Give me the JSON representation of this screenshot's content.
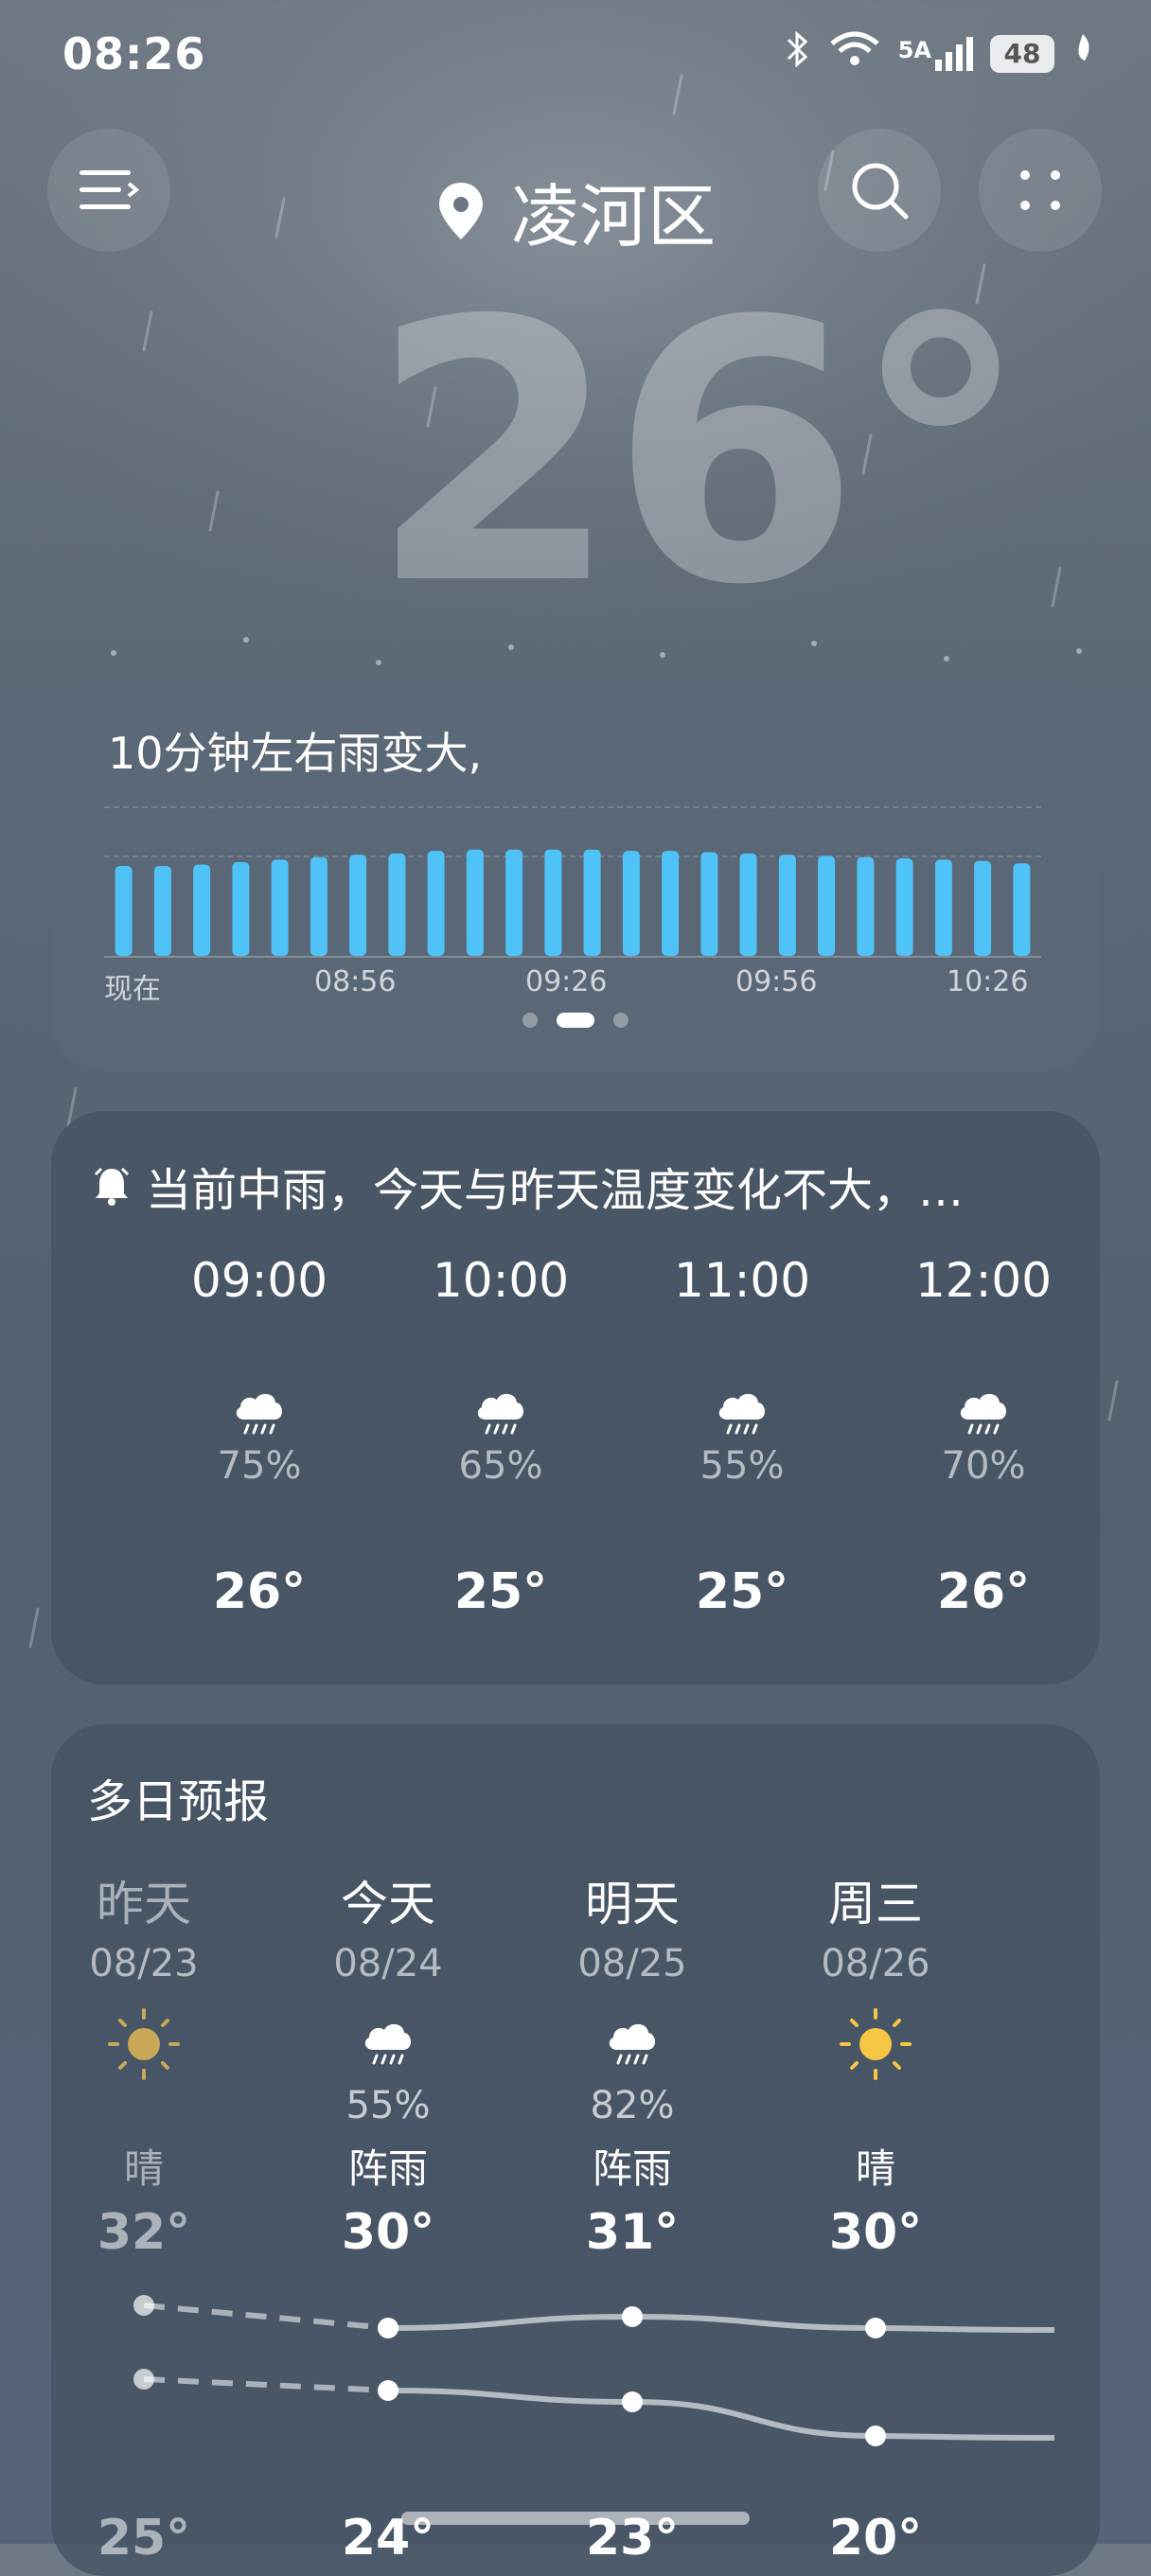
{
  "status_bar": {
    "time": "08:26",
    "network": "5A",
    "battery": "48"
  },
  "header": {
    "location": "凌河区"
  },
  "current": {
    "temperature": "26°"
  },
  "precip_card": {
    "message": "10分钟左右雨变大,",
    "bar_levels": [
      0.72,
      0.72,
      0.73,
      0.75,
      0.77,
      0.79,
      0.81,
      0.82,
      0.84,
      0.85,
      0.85,
      0.85,
      0.85,
      0.84,
      0.84,
      0.83,
      0.82,
      0.81,
      0.8,
      0.79,
      0.78,
      0.77,
      0.76,
      0.74
    ],
    "axis_labels": [
      "现在",
      "08:56",
      "09:26",
      "09:56",
      "10:26"
    ],
    "page_index": 1,
    "page_count": 3
  },
  "hourly_card": {
    "summary": "当前中雨，今天与昨天温度变化不大，…",
    "hours": [
      {
        "time": "09:00",
        "icon": "rain-cloud-icon",
        "precip": "75%",
        "temp": "26°"
      },
      {
        "time": "10:00",
        "icon": "rain-cloud-icon",
        "precip": "65%",
        "temp": "25°"
      },
      {
        "time": "11:00",
        "icon": "rain-cloud-icon",
        "precip": "55%",
        "temp": "25°"
      },
      {
        "time": "12:00",
        "icon": "rain-cloud-icon",
        "precip": "70%",
        "temp": "26°"
      }
    ]
  },
  "daily_card": {
    "title": "多日预报",
    "days": [
      {
        "name": "昨天",
        "date": "08/23",
        "icon": "sun-icon",
        "precip": "",
        "condition": "晴",
        "high": "32°",
        "low": "25°",
        "high_value": 32,
        "low_value": 25,
        "past": true
      },
      {
        "name": "今天",
        "date": "08/24",
        "icon": "rain-cloud-icon",
        "precip": "55%",
        "condition": "阵雨",
        "high": "30°",
        "low": "24°",
        "high_value": 30,
        "low_value": 24,
        "past": false
      },
      {
        "name": "明天",
        "date": "08/25",
        "icon": "rain-cloud-icon",
        "precip": "82%",
        "condition": "阵雨",
        "high": "31°",
        "low": "23°",
        "high_value": 31,
        "low_value": 23,
        "past": false
      },
      {
        "name": "周三",
        "date": "08/26",
        "icon": "sun-icon",
        "precip": "",
        "condition": "晴",
        "high": "30°",
        "low": "20°",
        "high_value": 30,
        "low_value": 20,
        "past": false
      }
    ]
  },
  "colors": {
    "bar": "#4fc3f7",
    "sun_past": "#c9a85a",
    "sun": "#f6c744"
  }
}
